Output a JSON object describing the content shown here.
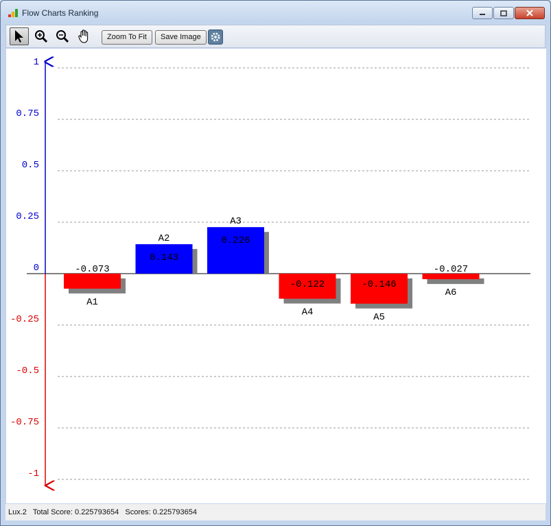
{
  "window": {
    "title": "Flow Charts Ranking"
  },
  "toolbar": {
    "tools": [
      "pointer-icon",
      "zoom-in-icon",
      "zoom-out-icon",
      "pan-hand-icon"
    ],
    "zoom_to_fit_label": "Zoom To Fit",
    "save_image_label": "Save Image",
    "settings_icon": "gear-icon"
  },
  "status_bar": {
    "text": "Lux.2   Total Score: 0.225793654   Scores: 0.225793654"
  },
  "colors": {
    "positive": "#0000ff",
    "negative": "#ff0000",
    "shadow": "#808080",
    "positive_axis": "#0000cc",
    "negative_axis": "#dd0000"
  },
  "chart_data": {
    "type": "bar",
    "categories": [
      "A1",
      "A2",
      "A3",
      "A4",
      "A5",
      "A6"
    ],
    "values": [
      -0.073,
      0.143,
      0.226,
      -0.122,
      -0.146,
      -0.027
    ],
    "value_labels": [
      "-0.073",
      "0.143",
      "0.226",
      "-0.122",
      "-0.146",
      "-0.027"
    ],
    "ylim": [
      -1,
      1
    ],
    "yticks": [
      1,
      0.75,
      0.5,
      0.25,
      0,
      -0.25,
      -0.5,
      -0.75,
      -1
    ],
    "ytick_labels": [
      "1",
      "0.75",
      "0.5",
      "0.25",
      "0",
      "-0.25",
      "-0.5",
      "-0.75",
      "-1"
    ],
    "grid": true,
    "title": "",
    "xlabel": "",
    "ylabel": ""
  }
}
